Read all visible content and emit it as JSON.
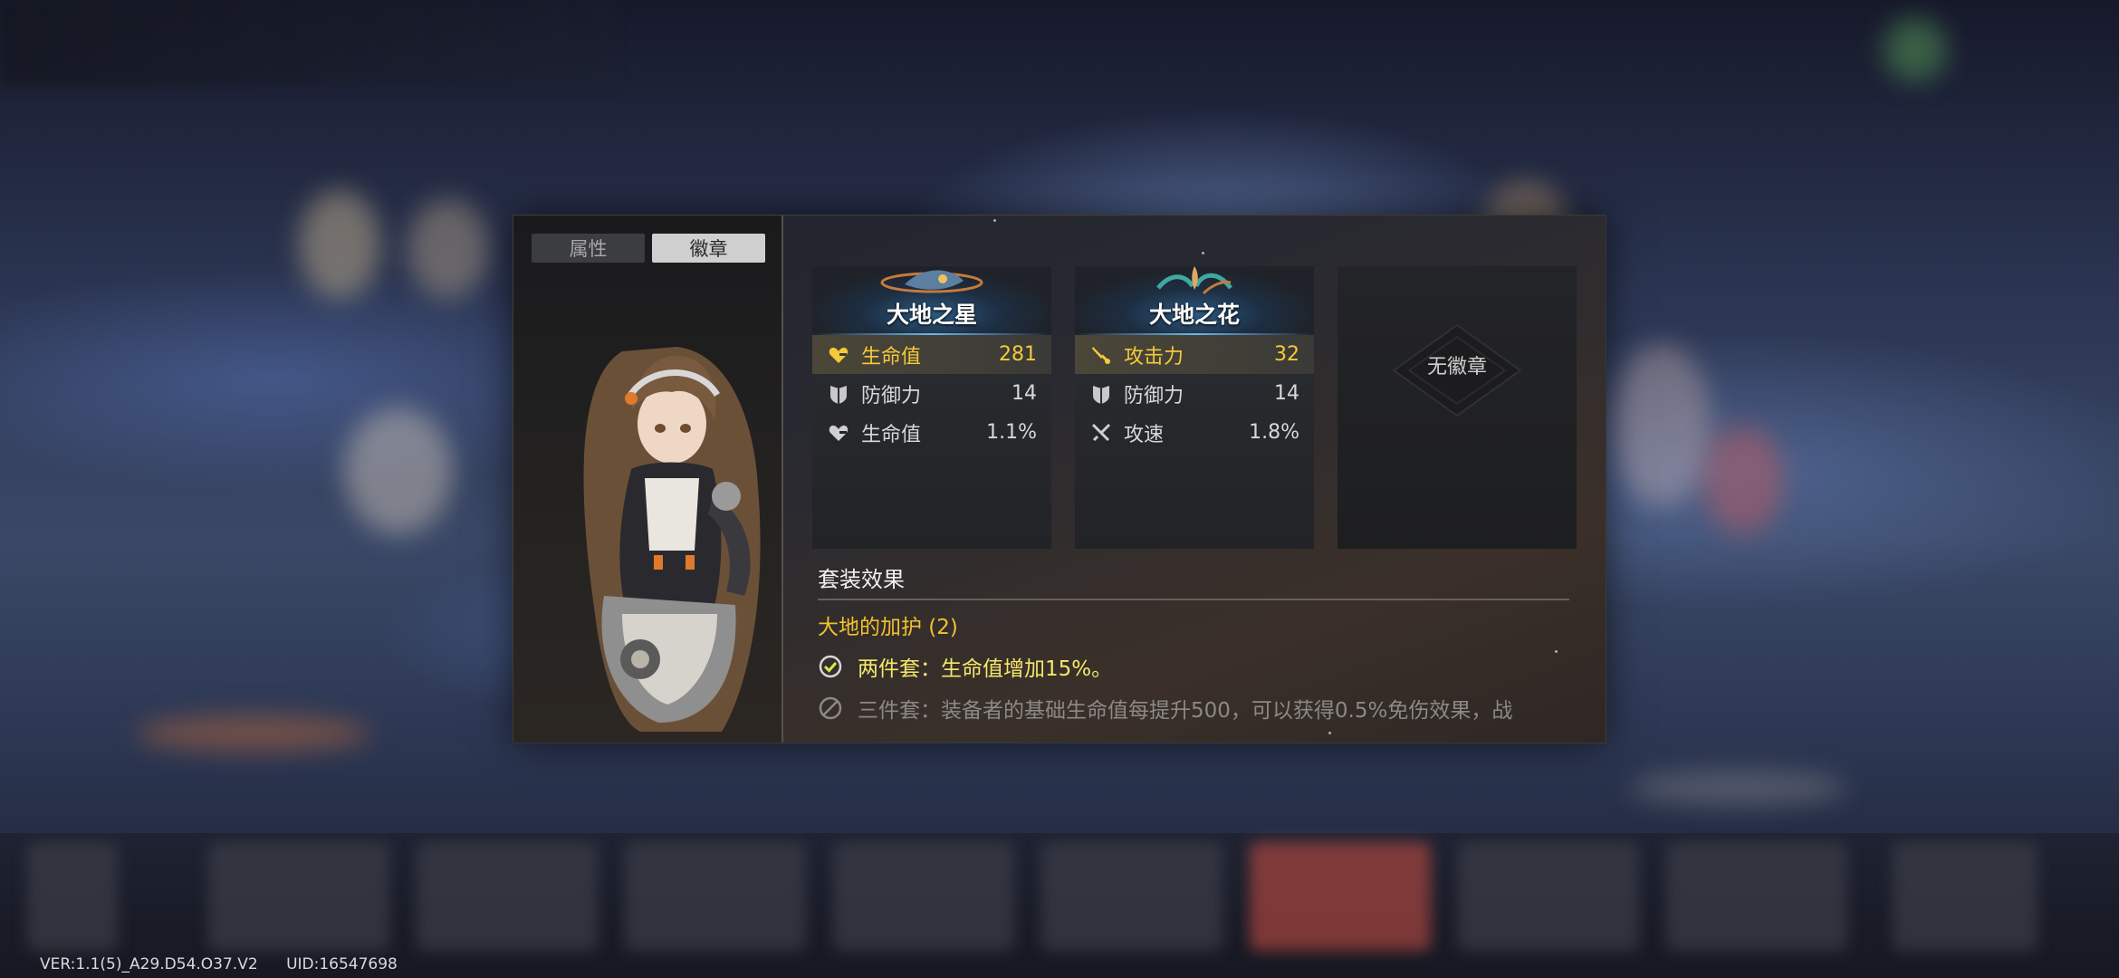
{
  "tabs": [
    {
      "label": "属性",
      "active": false
    },
    {
      "label": "徽章",
      "active": true
    }
  ],
  "emblems": [
    {
      "name": "大地之星",
      "stats": [
        {
          "icon": "heart-icon",
          "label": "生命值",
          "value": "281",
          "main": true
        },
        {
          "icon": "shield-icon",
          "label": "防御力",
          "value": "14",
          "main": false
        },
        {
          "icon": "heart-icon",
          "label": "生命值",
          "value": "1.1%",
          "main": false
        }
      ]
    },
    {
      "name": "大地之花",
      "stats": [
        {
          "icon": "sword-icon",
          "label": "攻击力",
          "value": "32",
          "main": true
        },
        {
          "icon": "shield-icon",
          "label": "防御力",
          "value": "14",
          "main": false
        },
        {
          "icon": "crossed-swords-icon",
          "label": "攻速",
          "value": "1.8%",
          "main": false
        }
      ]
    }
  ],
  "empty_slot_label": "无徽章",
  "set_effect": {
    "title": "套装效果",
    "name": "大地的加护 (2)",
    "lines": [
      {
        "text": "两件套：生命值增加15%。",
        "active": true,
        "icon": "check-circle-icon"
      },
      {
        "text": "三件套：装备者的基础生命值每提升500，可以获得0.5%免伤效果，战",
        "active": false,
        "icon": "disabled-circle-icon"
      }
    ]
  },
  "footer": {
    "version": "VER:1.1(5)_A29.D54.O37.V2",
    "uid": "UID:16547698"
  },
  "colors": {
    "accent_gold": "#f2c12e",
    "active_set": "#f5e86a",
    "tab_active": "#cfcfcf"
  }
}
